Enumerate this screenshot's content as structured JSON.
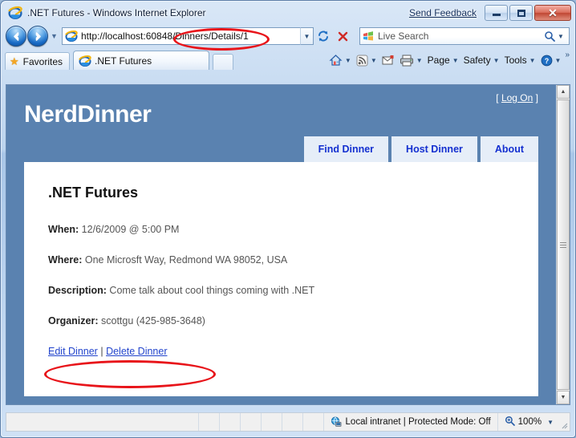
{
  "browser": {
    "window_title": ".NET Futures - Windows Internet Explorer",
    "send_feedback": "Send Feedback",
    "window_buttons": {
      "minimize": "minimize-button",
      "maximize": "maximize-button",
      "close": "close-button"
    },
    "navigation": {
      "back": "back-button",
      "forward": "forward-button",
      "recent_pages": "recent-pages-dropdown",
      "url": "http://localhost:60848/Dinners/Details/1",
      "url_visible": "http://localhost:6084",
      "url_highlight": "/Dinners/Details/1",
      "refresh": "refresh-button",
      "stop": "stop-button"
    },
    "search": {
      "placeholder": "Live Search",
      "value": ""
    },
    "favorites_label": "Favorites",
    "tab_label": ".NET Futures",
    "commands": [
      {
        "label": "Page",
        "has_caret": true
      },
      {
        "label": "Safety",
        "has_caret": true
      },
      {
        "label": "Tools",
        "has_caret": true
      }
    ],
    "command_icons": [
      "home-icon",
      "feeds-icon",
      "read-mail-icon",
      "print-icon"
    ],
    "overflow": "»",
    "status": {
      "zone": "Local intranet | Protected Mode: Off",
      "zoom": "100%"
    }
  },
  "page": {
    "logo": "NerdDinner",
    "logon_prefix": "[",
    "logon_label": "Log On",
    "logon_suffix": "]",
    "nav_tabs": [
      {
        "label": "Find Dinner"
      },
      {
        "label": "Host Dinner"
      },
      {
        "label": "About"
      }
    ],
    "dinner": {
      "title": ".NET Futures",
      "when_label": "When:",
      "when_value": "12/6/2009 @ 5:00 PM",
      "where_label": "Where:",
      "where_value": "One Microsft Way, Redmond WA 98052, USA",
      "description_label": "Description:",
      "description_value": "Come talk about cool things coming with .NET",
      "organizer_label": "Organizer:",
      "organizer_value": "scottgu (425-985-3648)",
      "edit_link": "Edit Dinner",
      "link_separator": "|",
      "delete_link": "Delete Dinner"
    }
  },
  "colors": {
    "page_background": "#5a82b0",
    "nav_tab_text": "#1430d0",
    "link": "#2244cc",
    "annotation": "#e8141a"
  }
}
